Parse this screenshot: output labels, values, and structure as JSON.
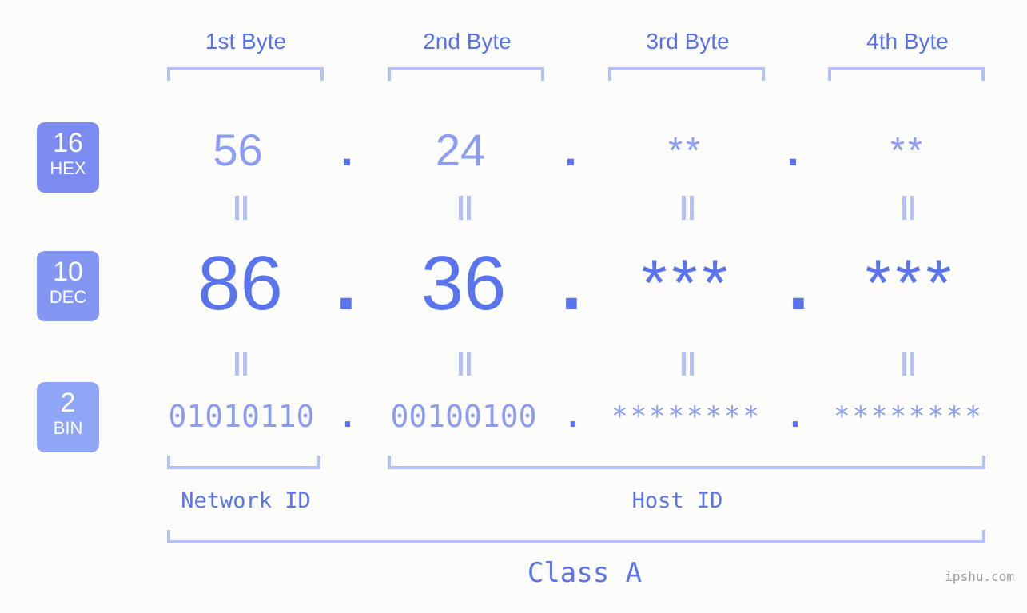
{
  "watermark": "ipshu.com",
  "columns": [
    {
      "label": "1st Byte"
    },
    {
      "label": "2nd Byte"
    },
    {
      "label": "3rd Byte"
    },
    {
      "label": "4th Byte"
    }
  ],
  "bases": [
    {
      "num": "16",
      "abbr": "HEX",
      "color": "#7b8bef"
    },
    {
      "num": "10",
      "abbr": "DEC",
      "color": "#8296f2"
    },
    {
      "num": "2",
      "abbr": "BIN",
      "color": "#8fa6f7"
    }
  ],
  "rows": {
    "hex": {
      "values": [
        "56",
        "24",
        "**",
        "**"
      ],
      "separator": "."
    },
    "dec": {
      "values": [
        "86",
        "36",
        "***",
        "***"
      ],
      "separator": "."
    },
    "bin": {
      "values": [
        "01010110",
        "00100100",
        "********",
        "********"
      ],
      "separator": "."
    }
  },
  "equals_symbol": "=",
  "segments": {
    "network_id": "Network ID",
    "host_id": "Host ID",
    "class": "Class A"
  },
  "colors": {
    "background": "#fcfdfa",
    "accent_strong": "#5a74ee",
    "accent_light": "#8b9cf2",
    "bracket": "#b5c0f7",
    "badge_hex": "#7b8bef",
    "badge_dec": "#8296f2",
    "badge_bin": "#8fa6f7",
    "watermark": "#9b9b9b"
  }
}
